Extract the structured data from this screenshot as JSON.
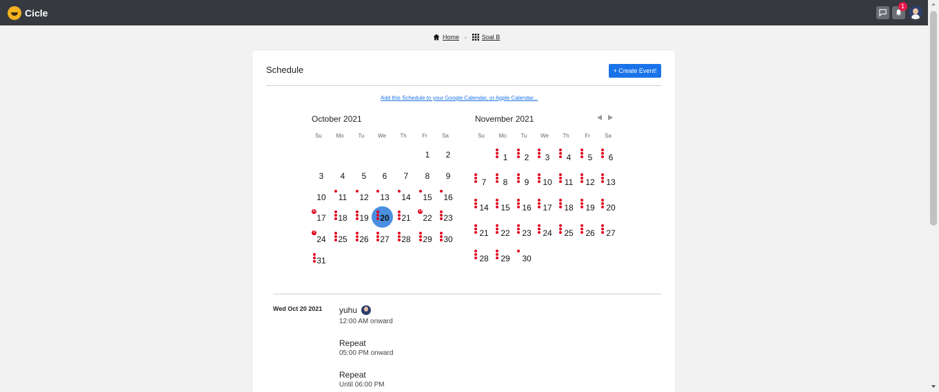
{
  "app": {
    "name": "Cicle",
    "notification_count": "1"
  },
  "breadcrumb": {
    "home": "Home",
    "team": "Soal B"
  },
  "schedule": {
    "title": "Schedule",
    "create_button": "+ Create Event!",
    "calendar_link": "Add this Schedule to your Google Calendar, or Apple Calendar..."
  },
  "calendar": {
    "weekdays": [
      "Su",
      "Mo",
      "Tu",
      "We",
      "Th",
      "Fr",
      "Sa"
    ],
    "october": {
      "title": "October 2021",
      "today": "20"
    },
    "november": {
      "title": "November 2021"
    }
  },
  "events": {
    "date": "Wed Oct 20 2021",
    "items": [
      {
        "title": "yuhu",
        "time": "12:00 AM onward"
      },
      {
        "title": "Repeat",
        "time": "05:00 PM onward"
      },
      {
        "title": "Repeat",
        "time": "Until 06:00 PM"
      }
    ]
  },
  "icons": [
    "cicle-logo-icon",
    "chat-icon",
    "bell-icon",
    "home-icon",
    "grid-icon",
    "chevron-left-icon",
    "chevron-right-icon"
  ]
}
